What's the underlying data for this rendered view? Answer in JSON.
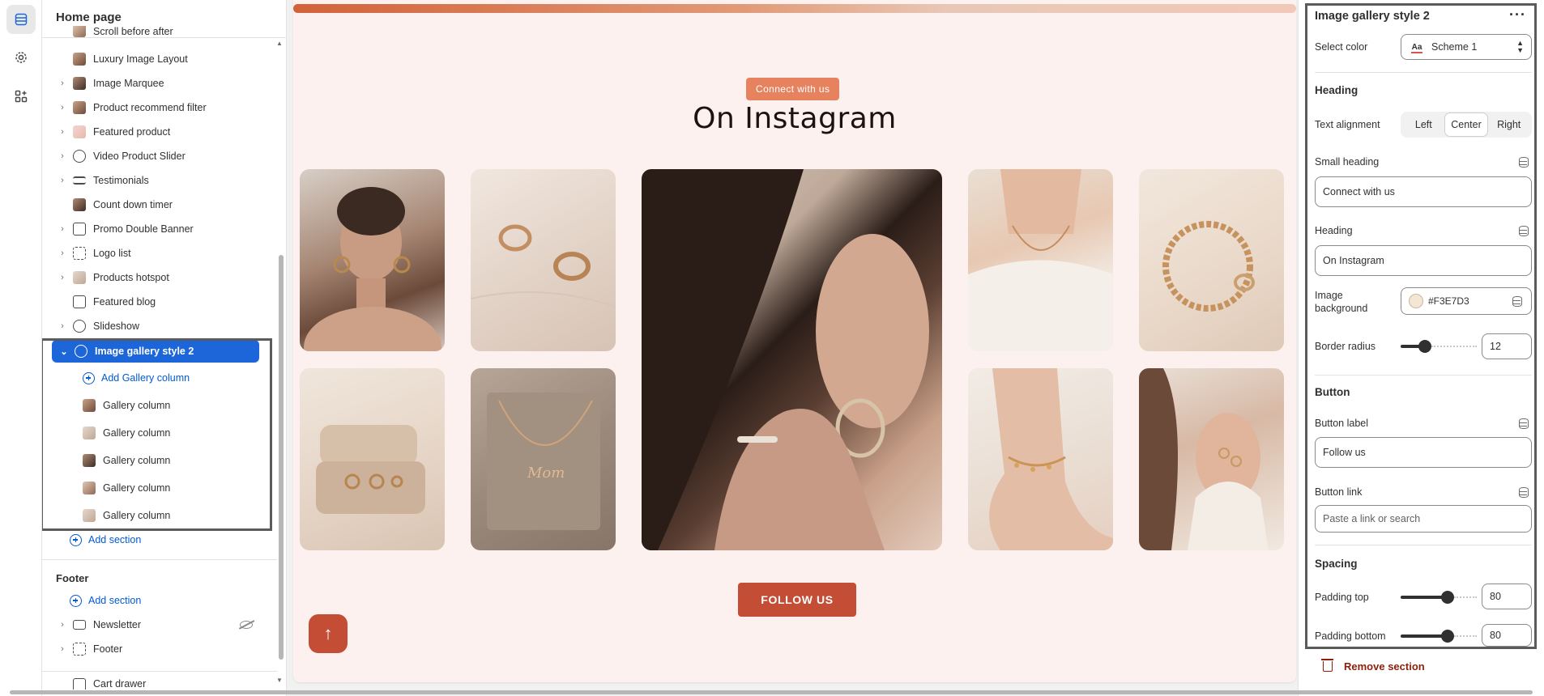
{
  "sidebar": {
    "title": "Home page",
    "items": [
      {
        "label": "Scroll before after",
        "expandable": false
      },
      {
        "label": "Luxury Image Layout",
        "expandable": false
      },
      {
        "label": "Image Marquee",
        "expandable": true
      },
      {
        "label": "Product recommend filter",
        "expandable": true
      },
      {
        "label": "Featured product",
        "expandable": true
      },
      {
        "label": "Video Product Slider",
        "expandable": true
      },
      {
        "label": "Testimonials",
        "expandable": true
      },
      {
        "label": "Count down timer",
        "expandable": false
      },
      {
        "label": "Promo Double Banner",
        "expandable": true
      },
      {
        "label": "Logo list",
        "expandable": true
      },
      {
        "label": "Products hotspot",
        "expandable": true
      },
      {
        "label": "Featured blog",
        "expandable": false
      },
      {
        "label": "Slideshow",
        "expandable": true
      }
    ],
    "selected": {
      "label": "Image gallery style 2"
    },
    "add_gallery_column": "Add Gallery column",
    "children": [
      {
        "label": "Gallery column"
      },
      {
        "label": "Gallery column"
      },
      {
        "label": "Gallery column"
      },
      {
        "label": "Gallery column"
      },
      {
        "label": "Gallery column"
      }
    ],
    "add_section": "Add section",
    "footer": {
      "title": "Footer",
      "add_section": "Add section",
      "items": [
        {
          "label": "Newsletter",
          "hidden": true
        },
        {
          "label": "Footer",
          "hidden": false
        }
      ]
    },
    "cart_drawer": "Cart drawer"
  },
  "preview": {
    "small_heading": "Connect with us",
    "heading": "On Instagram",
    "button_label": "FOLLOW US",
    "scroll_top_icon": "arrow-up-icon",
    "background_color": "#F3E7D3",
    "page_bg": "#fcf1ee",
    "accent": "#c44d35"
  },
  "settings": {
    "title": "Image gallery style 2",
    "more_icon": "more-horizontal-icon",
    "select_color_label": "Select color",
    "select_color_value": "Scheme 1",
    "heading_section": "Heading",
    "text_alignment_label": "Text alignment",
    "alignment_options": [
      "Left",
      "Center",
      "Right"
    ],
    "alignment_selected": "Center",
    "small_heading_label": "Small heading",
    "small_heading_value": "Connect with us",
    "heading_label": "Heading",
    "heading_value": "On Instagram",
    "image_background_label": "Image background",
    "image_background_value": "#F3E7D3",
    "border_radius_label": "Border radius",
    "border_radius_value": "12",
    "button_section": "Button",
    "button_label_label": "Button label",
    "button_label_value": "Follow us",
    "button_link_label": "Button link",
    "button_link_placeholder": "Paste a link or search",
    "spacing_section": "Spacing",
    "padding_top_label": "Padding top",
    "padding_top_value": "80",
    "padding_bottom_label": "Padding bottom",
    "padding_bottom_value": "80",
    "remove_section": "Remove section"
  }
}
